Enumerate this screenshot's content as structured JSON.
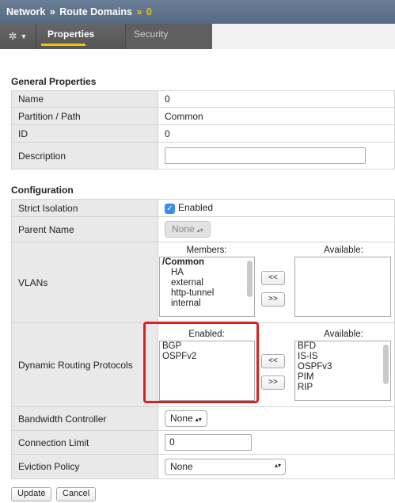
{
  "header": {
    "breadcrumb": [
      "Network",
      "Route Domains",
      "0"
    ],
    "separator": "»"
  },
  "tabs": [
    {
      "label": "Properties",
      "active": true
    },
    {
      "label": "Security",
      "active": false
    }
  ],
  "general": {
    "title": "General Properties",
    "rows": [
      {
        "label": "Name",
        "value": "0"
      },
      {
        "label": "Partition / Path",
        "value": "Common"
      },
      {
        "label": "ID",
        "value": "0"
      },
      {
        "label": "Description",
        "value": ""
      }
    ]
  },
  "configuration": {
    "title": "Configuration",
    "strict_isolation": {
      "label": "Strict Isolation",
      "checkbox_label": "Enabled",
      "checked": true
    },
    "parent_name": {
      "label": "Parent Name",
      "value": "None"
    },
    "vlans": {
      "label": "VLANs",
      "members_heading": "Members:",
      "available_heading": "Available:",
      "members": [
        "/Common",
        "HA",
        "external",
        "http-tunnel",
        "internal"
      ],
      "available": [],
      "move_left": "<<",
      "move_right": ">>"
    },
    "routing": {
      "label": "Dynamic Routing Protocols",
      "enabled_heading": "Enabled:",
      "available_heading": "Available:",
      "enabled": [
        "BGP",
        "OSPFv2"
      ],
      "available": [
        "BFD",
        "IS-IS",
        "OSPFv3",
        "PIM",
        "RIP"
      ],
      "move_left": "<<",
      "move_right": ">>"
    },
    "bandwidth": {
      "label": "Bandwidth Controller",
      "value": "None"
    },
    "connection_limit": {
      "label": "Connection Limit",
      "value": "0"
    },
    "eviction": {
      "label": "Eviction Policy",
      "value": "None"
    }
  },
  "footer": {
    "update": "Update",
    "cancel": "Cancel"
  },
  "colors": {
    "highlight": "#e02020",
    "accent": "#f3c200",
    "header": "#5f738b"
  }
}
